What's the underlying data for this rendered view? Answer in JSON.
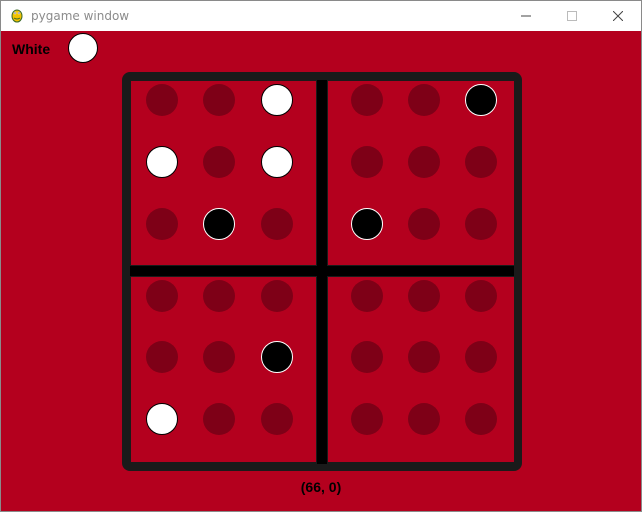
{
  "window": {
    "title": "pygame window"
  },
  "turn": {
    "label": "White",
    "stone": "white"
  },
  "board": {
    "quadrants": [
      {
        "name": "top-left",
        "cells": [
          [
            "empty",
            "empty",
            "white"
          ],
          [
            "white",
            "empty",
            "white"
          ],
          [
            "empty",
            "black",
            "empty"
          ]
        ]
      },
      {
        "name": "top-right",
        "cells": [
          [
            "empty",
            "empty",
            "black"
          ],
          [
            "empty",
            "empty",
            "empty"
          ],
          [
            "black",
            "empty",
            "empty"
          ]
        ]
      },
      {
        "name": "bottom-left",
        "cells": [
          [
            "empty",
            "empty",
            "empty"
          ],
          [
            "empty",
            "empty",
            "black"
          ],
          [
            "white",
            "empty",
            "empty"
          ]
        ]
      },
      {
        "name": "bottom-right",
        "cells": [
          [
            "empty",
            "empty",
            "empty"
          ],
          [
            "empty",
            "empty",
            "empty"
          ],
          [
            "empty",
            "empty",
            "empty"
          ]
        ]
      }
    ]
  },
  "status": {
    "coordinates": "(66, 0)"
  },
  "colors": {
    "background": "#b4001e",
    "empty_hole": "#7e0017",
    "board_frame": "#1a1a1a"
  }
}
